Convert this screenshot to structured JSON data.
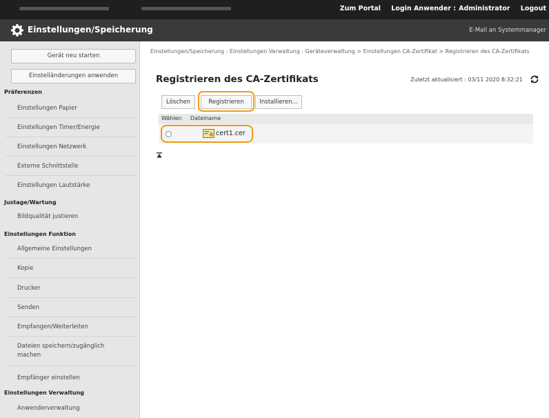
{
  "header": {
    "portal_link": "Zum Portal",
    "login_user_label": "Login Anwender :",
    "user_name": "Administrator",
    "logout_link": "Logout"
  },
  "titlebar": {
    "title": "Einstellungen/Speicherung",
    "mail_link": "E-Mail an Systemmanager"
  },
  "sidebar": {
    "buttons": {
      "restart": "Gerät neu starten",
      "apply": "Einstelländerungen anwenden"
    },
    "sections": {
      "preferences": "Präferenzen",
      "adjustment": "Justage/Wartung",
      "function": "Einstellungen Funktion",
      "management": "Einstellungen Verwaltung"
    },
    "items": {
      "paper": "Einstellungen Papier",
      "timer": "Einstellungen Timer/Energie",
      "network": "Einstellungen Netzwerk",
      "external": "Externe Schnittstelle",
      "volume": "Einstellungen Lautstärke",
      "image_quality": "Bildqualität justieren",
      "general": "Allgemeine Einstellungen",
      "copy": "Kopie",
      "printer": "Drucker",
      "send": "Senden",
      "receive": "Empfangen/Weiterleiten",
      "store_access": "Dateien speichern/zugänglich machen",
      "recipients": "Empfänger einstellen",
      "user_management": "Anwenderverwaltung"
    }
  },
  "main": {
    "breadcrumb": "Einstellungen/Speicherung : Einstellungen Verwaltung : Geräteverwaltung > Einstellungen CA-Zertifikat > Registrieren des CA-Zertifikats",
    "title": "Registrieren des CA-Zertifikats",
    "updated": "Zuletzt aktualisiert : 03/11 2020 8:32:21",
    "toolbar": {
      "delete": "Löschen",
      "register": "Registrieren",
      "install": "Installieren..."
    },
    "table": {
      "col_select": "Wählen",
      "col_filename": "Dateiname",
      "rows": [
        {
          "filename": "cert1.cer"
        }
      ]
    }
  },
  "colors": {
    "highlight": "#f29a13",
    "topbar": "#1f1f1f",
    "titlebar": "#3a3a3a",
    "sidebar": "#e6e6e6"
  }
}
